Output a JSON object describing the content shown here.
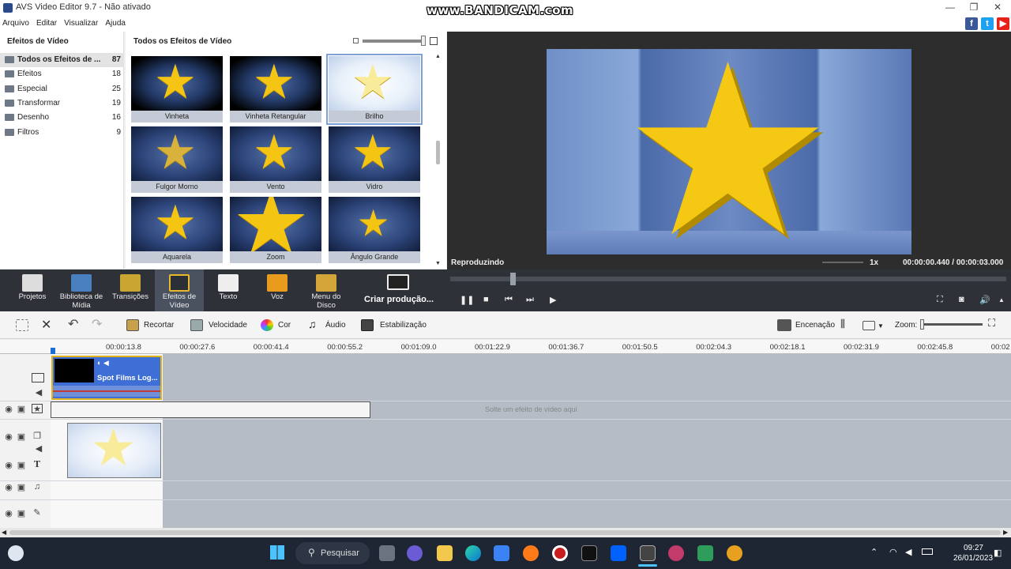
{
  "window": {
    "title": "AVS Video Editor 9.7 - Não ativado",
    "watermark": "www.BANDICAM.com",
    "controls": [
      "—",
      "❐",
      "✕"
    ]
  },
  "menu": [
    "Arquivo",
    "Editar",
    "Visualizar",
    "Ajuda"
  ],
  "social": [
    "f",
    "t",
    "▶"
  ],
  "categories": {
    "title": "Efeitos de Vídeo",
    "items": [
      {
        "label": "Todos os Efeitos de ...",
        "count": "87",
        "selected": true
      },
      {
        "label": "Efeitos",
        "count": "18"
      },
      {
        "label": "Especial",
        "count": "25"
      },
      {
        "label": "Transformar",
        "count": "19"
      },
      {
        "label": "Desenho",
        "count": "16"
      },
      {
        "label": "Filtros",
        "count": "9"
      }
    ]
  },
  "effects": {
    "title": "Todos os Efeitos de Vídeo",
    "tiles": [
      {
        "name": "Vinheta",
        "style": "dark"
      },
      {
        "name": "Vinheta Retangular",
        "style": "dark"
      },
      {
        "name": "Brilho",
        "style": "bright",
        "selected": true
      },
      {
        "name": "Fulgor Morno",
        "style": "normal"
      },
      {
        "name": "Vento",
        "style": "normal"
      },
      {
        "name": "Vidro",
        "style": "normal"
      },
      {
        "name": "Aquarela",
        "style": "normal"
      },
      {
        "name": "Zoom",
        "style": "normal"
      },
      {
        "name": "Ângulo Grande",
        "style": "normal"
      }
    ]
  },
  "preview": {
    "status": "Reproduzindo",
    "speed": "1x",
    "time": "00:00:00.440 / 00:00:03.000"
  },
  "toolbar": {
    "items": [
      {
        "label": "Projetos",
        "icon": "clapper-icon"
      },
      {
        "label": "Biblioteca de Mídia",
        "icon": "film-icon"
      },
      {
        "label": "Transições",
        "icon": "transition-icon"
      },
      {
        "label": "Efeitos de Vídeo",
        "icon": "star-effect-icon",
        "selected": true
      },
      {
        "label": "Texto",
        "icon": "text-icon"
      },
      {
        "label": "Voz",
        "icon": "microphone-icon"
      },
      {
        "label": "Menu do Disco",
        "icon": "disc-icon"
      }
    ],
    "produce": "Criar produção..."
  },
  "edit_tools": {
    "recortar": "Recortar",
    "velocidade": "Velocidade",
    "cor": "Cor",
    "audio": "Áudio",
    "estabilizacao": "Estabilização",
    "encenacao": "Encenação",
    "zoom": "Zoom:"
  },
  "ruler": [
    "00:00:13.8",
    "00:00:27.6",
    "00:00:41.4",
    "00:00:55.2",
    "00:01:09.0",
    "00:01:22.9",
    "00:01:36.7",
    "00:01:50.5",
    "00:02:04.3",
    "00:02:18.1",
    "00:02:31.9",
    "00:02:45.8",
    "00:02"
  ],
  "timeline": {
    "clip_name": "Spot Films Log...",
    "drop_hint": "Solte um efeito de vídeo aqui"
  },
  "taskbar": {
    "search": "Pesquisar",
    "time": "09:27",
    "date": "26/01/2023"
  }
}
